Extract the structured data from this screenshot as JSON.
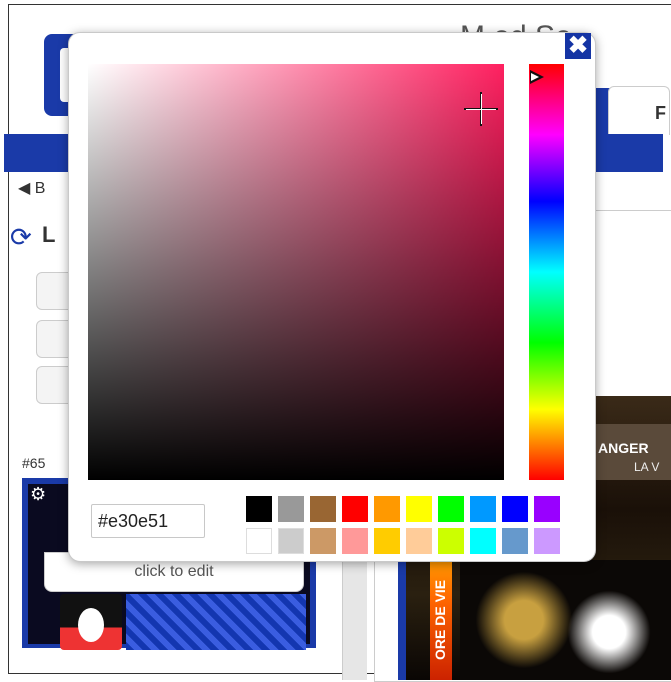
{
  "background": {
    "title_fragment": "M      ed Se",
    "tab_fragment": "F",
    "back_fragment": "B",
    "heading_fragment": "L",
    "item_id_fragment": "#65",
    "click_to_edit": "click to edit",
    "banner_text": "ANGER",
    "banner_sub": "LA V",
    "vertical_text": "ORE DE VIE"
  },
  "color_picker": {
    "hex_value": "#e30e51",
    "close_icon": "close-icon",
    "current_hue": "#ff2060",
    "swatches_row1": [
      "#000000",
      "#999999",
      "#996633",
      "#ff0000",
      "#ff9900",
      "#ffff00",
      "#00ff00",
      "#0099ff",
      "#0000ff",
      "#9900ff"
    ],
    "swatches_row2": [
      "#ffffff",
      "#cccccc",
      "#cc9966",
      "#ff9999",
      "#ffcc00",
      "#ffcc99",
      "#ccff00",
      "#00ffff",
      "#6699cc",
      "#cc99ff"
    ]
  }
}
